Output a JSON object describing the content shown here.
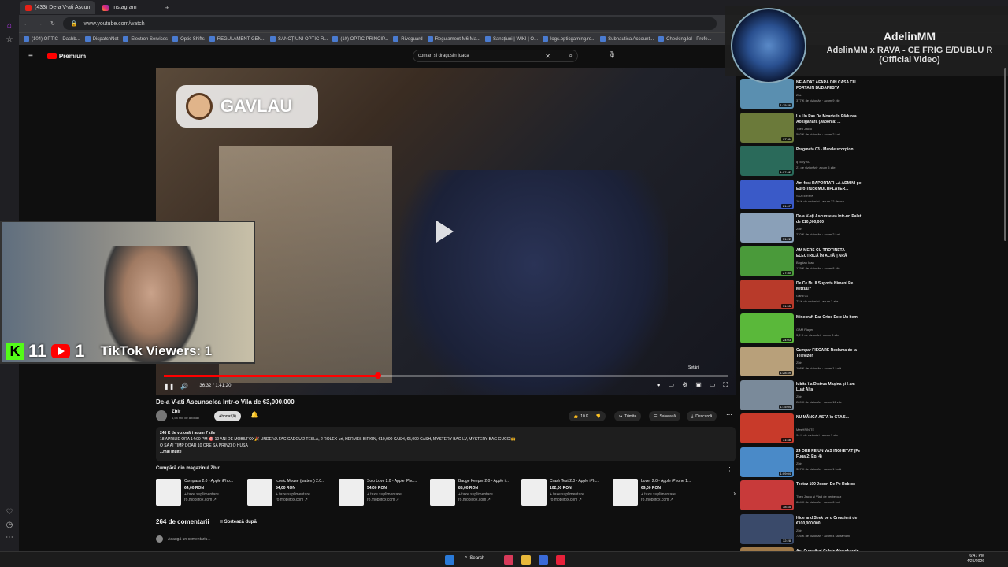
{
  "browser": {
    "tabs": [
      {
        "label": "(433) De-a V-ati Ascun"
      },
      {
        "label": "Instagram"
      }
    ],
    "url": "www.youtube.com/watch",
    "bookmarks": [
      "(104) OPTIC - Dashb...",
      "DispatchNet",
      "Electron Services",
      "Optic Shifts",
      "REGULAMENT GEN...",
      "SANCȚIUNI OPTIC R...",
      "(10) OPTIC PRINCIP...",
      "Riveguard",
      "Regulament M6 Ma...",
      "Sancțiuni | WIKI | O...",
      "logs.opticgaming.ro...",
      "Subnautica Account...",
      "Checking.lol - Profe..."
    ]
  },
  "youtube": {
    "logo": "Premium",
    "search_value": "coman si dragusin joaca"
  },
  "video": {
    "overlay_name": "GAVLAU",
    "time": "36:32 / 1:41:20",
    "progress": 0.38,
    "tooltip": "Setări",
    "title": "De-a V-ati Ascunselea Intr-o Vila de €3,000,000",
    "channel": "Zbir",
    "subscribers": "1,58 mil. de abonați",
    "subscribe_label": "Abonat(ă)",
    "likes": "10 K",
    "share_label": "Trimite",
    "save_label": "Salvează",
    "download_label": "Descarcă",
    "desc_line1": "248 K de vizionări  acum 7 zile",
    "desc_line2": "18 APRILIE ORA 14:00 PM 🎯 10 ANI DE MOBILFOX🎉 UNDE VA FAC CADOU 2 TESLA, 2 ROLEX-uri, HERMES BIRKIN, €10,000 CASH, €5,000 CASH, MYSTERY BAG LV, MYSTERY BAG GUCCI🙌",
    "desc_line3": "O SA AI TIMP DOAR 10 ORE SA PRINZI O HUSA",
    "desc_more": "...mai multe"
  },
  "shop": {
    "header": "Cumpără din magazinul Zbir",
    "products": [
      {
        "title": "Compass 2.0 - Apple iPho...",
        "price": "64,00 RON",
        "tax": "+ taxe suplimentare",
        "site": "ro.mobilfox.com ↗"
      },
      {
        "title": "Iconic Mouse (pattern) 2.0...",
        "price": "54,00 RON",
        "tax": "+ taxe suplimentare",
        "site": "ro.mobilfox.com ↗"
      },
      {
        "title": "Solo Love 2.0 - Apple iPho...",
        "price": "54,00 RON",
        "tax": "+ taxe suplimentare",
        "site": "ro.mobilfox.com ↗"
      },
      {
        "title": "Badge Keeper 2.0 - Apple i...",
        "price": "85,00 RON",
        "tax": "+ taxe suplimentare",
        "site": "ro.mobilfox.com ↗"
      },
      {
        "title": "Crash Test 2.0 - Apple iPh...",
        "price": "102,00 RON",
        "tax": "+ taxe suplimentare",
        "site": "ro.mobilfox.com ↗"
      },
      {
        "title": "Lover 2.0 - Apple iPhone 1...",
        "price": "69,00 RON",
        "tax": "+ taxe suplimentare",
        "site": "ro.mobilfox.com ↗"
      }
    ]
  },
  "comments": {
    "count": "264 de comentarii",
    "sort_label": "Sortează după",
    "add_placeholder": "Adaugă un comentariu..."
  },
  "webcam": {
    "kick_count": "11",
    "yt_count": "1",
    "tiktok": "TikTok Viewers: 1"
  },
  "now_playing": {
    "artist": "AdelinMM",
    "song": "AdelinMM x RAVA - CE FRIG E/DUBLU R (Official Video)"
  },
  "recommendations": [
    {
      "title": "NE-A DAT AFARA DIN CASA CU FORTA IN BUDAPESTA",
      "channel": "Zbir",
      "views": "377 K de vizionări · acum 9 zile",
      "duration": "1:15:26",
      "color": "#5a8fb0"
    },
    {
      "title": "La Un Pas De Moarte în Pădurea Aokigahara (Japonia: ...",
      "channel": "Theo Zaciu",
      "views": "592 K de vizionări · acum 2 luni",
      "duration": "27:11",
      "color": "#6b7a3a"
    },
    {
      "title": "Pragmata 03 - Marele scorpion",
      "channel": "qTicky XD",
      "views": "21 de vizionări · acum 5 zile",
      "duration": "1:07:42",
      "color": "#2a6a5a"
    },
    {
      "title": "Am fost RAPORTATI LA ADMINI pe Euro Truck MULTIPLAYER...",
      "channel": "SKATERPIK",
      "views": "16 K de vizionări · acum 22 de ore",
      "duration": "21:07",
      "color": "#3a5ac8"
    },
    {
      "title": "De-a V-ați Ascunselea într-un Palat de €10,000,000",
      "channel": "Zbir",
      "views": "270 K de vizionări · acum 2 luni",
      "duration": "51:22",
      "color": "#8aa0b8"
    },
    {
      "title": "AM MERS CU TROTINETA ELECTRICĂ ÎN ALTĂ ȚARĂ",
      "channel": "Bogdan Ioan",
      "views": "179 K de vizionări · acum 8 zile",
      "duration": "27:30",
      "color": "#4a9a3a"
    },
    {
      "title": "De Ce Nu Il Suporta Nimeni Pe Mitzuu?",
      "channel": "Gami 01",
      "views": "72 K de vizionări · acum 2 zile",
      "duration": "31:55",
      "color": "#b83a2a"
    },
    {
      "title": "Minecraft Dar Orice Este Un Item",
      "channel": "GAM Player",
      "views": "3,2 K de vizionări · acum 3 zile",
      "duration": "24:03",
      "color": "#5ab83a"
    },
    {
      "title": "Cumpar FIECARE Reclama de la Televizor",
      "channel": "Zbir",
      "views": "198 K de vizionări · acum 1 lună",
      "duration": "1:28:49",
      "color": "#b8a07a"
    },
    {
      "title": "Iubita î-a Distrus Mașina și I-am Luat Alta",
      "channel": "Zbir",
      "views": "289 K de vizionări · acum 12 zile",
      "duration": "1:15:04",
      "color": "#7a8a9a"
    },
    {
      "title": "NU MÂNCA ASTA în GTA 5...",
      "channel": "MesHFINITE",
      "views": "94 K de vizionări · acum 7 zile",
      "duration": "31:48",
      "color": "#c83a2a"
    },
    {
      "title": "24 ORE PE UN VAS INGHEȚAT (Fe Fuga 2: Ep. 4)",
      "channel": "Zbir",
      "views": "307 K de vizionări · acum 1 lună",
      "duration": "1:09:04",
      "color": "#4a8ac8"
    },
    {
      "title": "Testez 100 Jocuri De Pe Roblox",
      "channel": "Theo Zaciu și Vlad de berbecutz",
      "views": "864 K de vizionări · acum 6 luni",
      "duration": "38:45",
      "color": "#c83a3a"
    },
    {
      "title": "Hide and Seek pe o Croazieră de €100,000,000",
      "channel": "Zbir",
      "views": "726 K de vizionări · acum 4 săptămâni",
      "duration": "32:28",
      "color": "#3a4a6a"
    },
    {
      "title": "Am Cumpărat Colete Abandonate De €5,000!",
      "channel": "",
      "views": "",
      "duration": "",
      "color": "#a07a4a"
    }
  ],
  "taskbar": {
    "search": "Search",
    "time": "6:41 PM",
    "date": "4/25/2026"
  }
}
